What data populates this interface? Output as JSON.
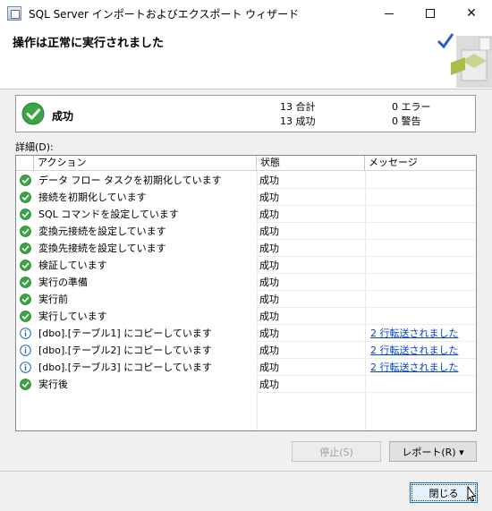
{
  "window": {
    "title": "SQL Server インポートおよびエクスポート ウィザード",
    "minimize_icon": "minimize-icon",
    "maximize_icon": "maximize-icon",
    "close_glyph": "✕"
  },
  "header": {
    "title": "操作は正常に実行されました"
  },
  "summary": {
    "status": "成功",
    "total_line": "13 合計",
    "success_line": "13 成功",
    "error_line": "0 エラー",
    "warning_line": "0 警告"
  },
  "details_label": "詳細(D):",
  "grid": {
    "columns": [
      "アクション",
      "状態",
      "メッセージ"
    ],
    "rows": [
      {
        "icon": "success-icon",
        "action": "データ フロー タスクを初期化しています",
        "status": "成功",
        "message": ""
      },
      {
        "icon": "success-icon",
        "action": "接続を初期化しています",
        "status": "成功",
        "message": ""
      },
      {
        "icon": "success-icon",
        "action": "SQL コマンドを設定しています",
        "status": "成功",
        "message": ""
      },
      {
        "icon": "success-icon",
        "action": "変換元接続を設定しています",
        "status": "成功",
        "message": ""
      },
      {
        "icon": "success-icon",
        "action": "変換先接続を設定しています",
        "status": "成功",
        "message": ""
      },
      {
        "icon": "success-icon",
        "action": "検証しています",
        "status": "成功",
        "message": ""
      },
      {
        "icon": "success-icon",
        "action": "実行の準備",
        "status": "成功",
        "message": ""
      },
      {
        "icon": "success-icon",
        "action": "実行前",
        "status": "成功",
        "message": ""
      },
      {
        "icon": "success-icon",
        "action": "実行しています",
        "status": "成功",
        "message": ""
      },
      {
        "icon": "info-icon",
        "action": "[dbo].[テーブル1] にコピーしています",
        "status": "成功",
        "message": "2 行転送されました"
      },
      {
        "icon": "info-icon",
        "action": "[dbo].[テーブル2] にコピーしています",
        "status": "成功",
        "message": "2 行転送されました"
      },
      {
        "icon": "info-icon",
        "action": "[dbo].[テーブル3] にコピーしています",
        "status": "成功",
        "message": "2 行転送されました"
      },
      {
        "icon": "success-icon",
        "action": "実行後",
        "status": "成功",
        "message": ""
      }
    ]
  },
  "buttons": {
    "stop": "停止(S)",
    "report": "レポート(R) ▾",
    "close": "閉じる"
  },
  "colors": {
    "success": "#3aa545",
    "info": "#1f5fb6",
    "link": "#0645c8"
  }
}
